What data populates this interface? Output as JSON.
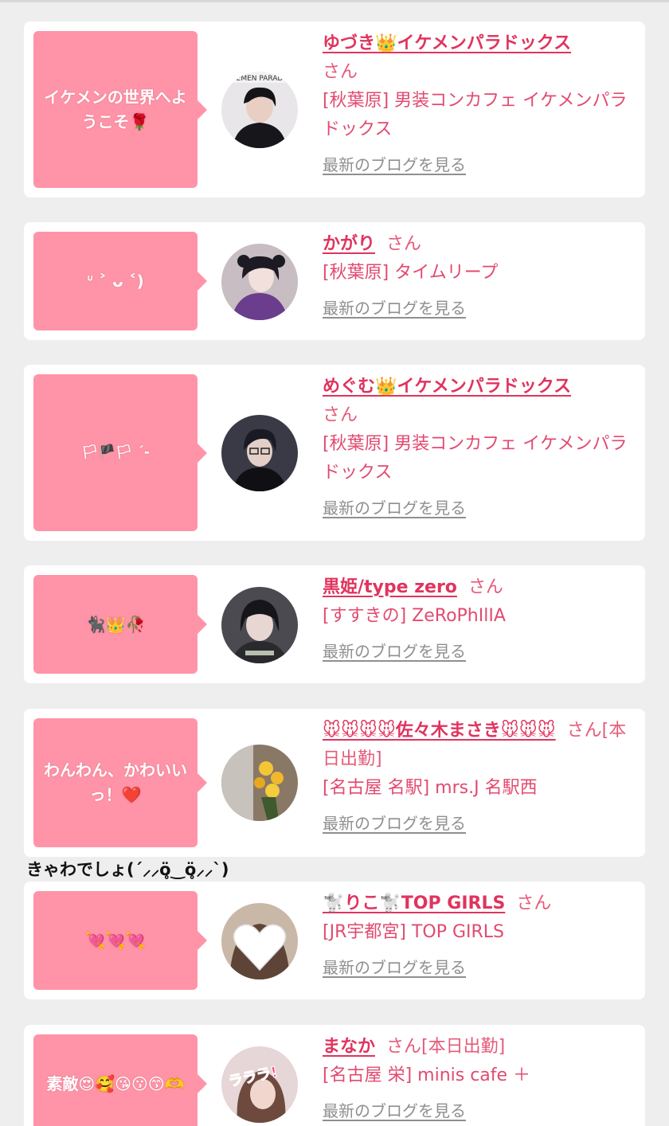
{
  "caption": "きゃわでしょ(ˊ⸝⸝ö̥‿ö̥⸝⸝ˋ)",
  "cards": [
    {
      "comment": "イケメンの世界へようこそ🌹",
      "name": "ゆづき👑イケメンパラドックス",
      "san": "さん",
      "status": "",
      "shop": "[秋葉原] 男装コンカフェ イケメンパラドックス",
      "blog": "最新のブログを見る",
      "avatar_logo": "EMEN PARAD"
    },
    {
      "comment": "ᐡ ˃ ᴗ ˂)",
      "name": "かがり",
      "san": "さん",
      "status": "",
      "shop": "[秋葉原] タイムリープ",
      "blog": "最新のブログを見る"
    },
    {
      "comment": "🏳🏴🏳 ˊ-",
      "name": "めぐむ👑イケメンパラドックス",
      "san": "さん",
      "status": "",
      "shop": "[秋葉原] 男装コンカフェ イケメンパラドックス",
      "blog": "最新のブログを見る"
    },
    {
      "comment": "🐈‍⬛👑🥀",
      "name": "黒姫/type zero",
      "san": "さん",
      "status": "",
      "shop": "[すすきの] ZeRoPhIlIA",
      "blog": "最新のブログを見る"
    },
    {
      "comment": "わんわん、かわいいっ！❤️",
      "name": "🐭🐭🐭🐭佐々木まさき🐭🐭🐭",
      "san": "さん",
      "status": "[本日出勤]",
      "shop": "[名古屋 名駅] mrs.J 名駅西",
      "blog": "最新のブログを見る"
    },
    {
      "comment": "💘💘💘",
      "name": "🐩りこ🐩TOP GIRLS",
      "san": "さん",
      "status": "",
      "shop": "[JR宇都宮] TOP GIRLS",
      "blog": "最新のブログを見る"
    },
    {
      "comment": "素敵😍🥰😘😗😙🫶",
      "name": "まなか",
      "san": "さん",
      "status": "[本日出勤]",
      "shop": "[名古屋 栄] minis cafe ＋",
      "blog": "最新のブログを見る",
      "avatar_logo": "ラララ!"
    }
  ],
  "colors": {
    "page_bg": "#eeeeee",
    "card_bg": "#ffffff",
    "bubble": "#ff94a8",
    "name": "#e0345e",
    "shop": "#e24a6f",
    "blog_link": "#8f8f8f"
  },
  "icons": [
    "heart-avatar-icon"
  ]
}
